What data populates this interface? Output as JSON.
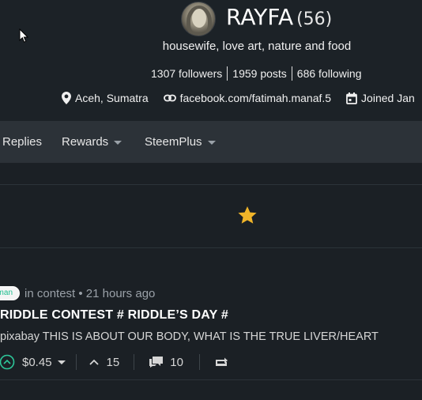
{
  "profile": {
    "name": "RAYFA",
    "reputation": "(56)",
    "about": "housewife, love art, nature and food",
    "followers": "1307 followers",
    "posts": "1959 posts",
    "following": "686 following",
    "location": "Aceh, Sumatra",
    "website": "facebook.com/fatimah.manaf.5",
    "joined": "Joined Jan"
  },
  "tabs": {
    "replies": "Replies",
    "rewards": "Rewards",
    "steemplus": "SteemPlus"
  },
  "post": {
    "tag": "uman",
    "context": "in contest • 21 hours ago",
    "title": "RIDDLE CONTEST # RIDDLE’S DAY #",
    "body": "pixabay THIS IS ABOUT OUR BODY, WHAT IS THE TRUE LIVER/HEART",
    "payout": "$0.45",
    "votes": "15",
    "comments": "10"
  },
  "colors": {
    "background": "#1b2025",
    "tabbar": "#2c3238",
    "star": "#f0b429",
    "tag_text": "#1fbf8f"
  },
  "icons": [
    "cursor-icon",
    "location-pin-icon",
    "link-icon",
    "calendar-icon",
    "caret-down-icon",
    "star-icon",
    "upvote-icon",
    "chevron-up-icon",
    "comments-icon",
    "resteem-icon"
  ]
}
